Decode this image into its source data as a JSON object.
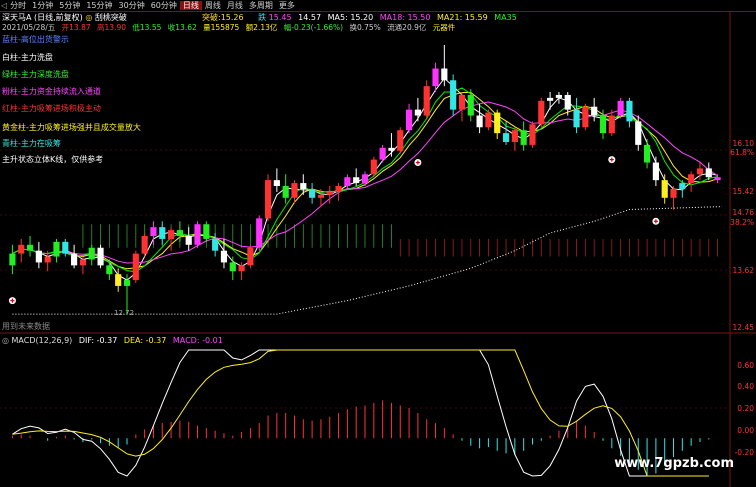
{
  "tabs": [
    "分时",
    "1分钟",
    "5分钟",
    "15分钟",
    "30分钟",
    "60分钟",
    "日线",
    "周线",
    "月线",
    "多周期",
    "更多"
  ],
  "active_tab": "日线",
  "header": {
    "stock": "深天马A (日线,前复权)",
    "indicator_prefix": "◎",
    "indicator": "刮桃突破",
    "breakout_label": "突破:",
    "breakout_value": "15.26",
    "fall_label": "跌",
    "fall_value": "15.45",
    "mid_value": "14.57",
    "ma5": "MA5: 15.20",
    "ma18": "MA18: 15.50",
    "ma21": "MA21: 15.59",
    "ma35": "MA35"
  },
  "info_bar": {
    "date": "2021/05/28/五",
    "open": "开13.87",
    "high": "高13.90",
    "low": "低13.55",
    "close": "收13.62",
    "volume": "量155875",
    "amount": "额2.13亿",
    "change": "幅-0.23(-1.66%)",
    "turnover": "换0.75%",
    "float_cap": "流通20.9亿",
    "unit": "元器件"
  },
  "legend": [
    {
      "text": "蓝柱-高位出货警示",
      "color": "#5a86ff"
    },
    {
      "text": "白柱-主力洗盘",
      "color": "#ffffff"
    },
    {
      "text": "绿柱-主力深度洗盘",
      "color": "#33ee33"
    },
    {
      "text": "粉柱-主力资金持续流入通道",
      "color": "#ff44ff"
    },
    {
      "text": "红柱-主力吸筹进场积极主动",
      "color": "#ff3333"
    },
    {
      "text": "黄金柱-主力吸筹进场强并且成交量放大",
      "color": "#ffee22"
    },
    {
      "text": "青柱-主力在吸筹",
      "color": "#33e6e6"
    },
    {
      "text": "主升状态立体K线，仅供参考",
      "color": "#ffffff"
    }
  ],
  "price_axis": [
    "16.10",
    "61.8%",
    "15.42",
    "14.76",
    "38.2%",
    "13.62",
    "12.45"
  ],
  "low_mark": "12.72",
  "future_note": "用到未来数据",
  "macd": {
    "title": "MACD(12,26,9)",
    "dif": "DIF: -0.37",
    "dea": "DEA: -0.37",
    "macd": "MACD: -0.01",
    "axis": [
      "0.60",
      "0.40",
      "0.20",
      "0.00",
      "-0.20"
    ]
  },
  "watermark": "www.7gpzb.com",
  "colors": {
    "up": "#ff3232",
    "down": "#33e6e6",
    "pink": "#ff33ff",
    "green": "#22ee22",
    "white": "#ffffff",
    "yellow": "#ffee22",
    "ma5": "#ffffff",
    "ma10": "#ffee22",
    "ma20": "#ff44ff",
    "ma30": "#00ee00",
    "grid": "#7a1414",
    "dif": "#ffffff",
    "dea": "#ffee22"
  },
  "chart_data": {
    "type": "candlestick",
    "price_range": [
      12.45,
      17.3
    ],
    "candles": [
      [
        13.55,
        13.9,
        13.4,
        13.75,
        "green"
      ],
      [
        13.75,
        14.0,
        13.6,
        13.9,
        "red"
      ],
      [
        13.9,
        14.05,
        13.7,
        13.8,
        "green"
      ],
      [
        13.8,
        13.95,
        13.5,
        13.6,
        "white"
      ],
      [
        13.6,
        13.8,
        13.45,
        13.7,
        "red"
      ],
      [
        13.7,
        14.0,
        13.6,
        13.95,
        "green"
      ],
      [
        13.95,
        14.0,
        13.7,
        13.75,
        "cyan"
      ],
      [
        13.75,
        13.9,
        13.5,
        13.55,
        "white"
      ],
      [
        13.55,
        13.7,
        13.4,
        13.65,
        "red"
      ],
      [
        13.65,
        13.9,
        13.55,
        13.85,
        "green"
      ],
      [
        13.85,
        13.9,
        13.5,
        13.55,
        "white"
      ],
      [
        13.55,
        13.65,
        13.3,
        13.4,
        "green"
      ],
      [
        13.4,
        13.5,
        13.1,
        13.2,
        "yellow"
      ],
      [
        13.2,
        13.4,
        12.72,
        13.3,
        "green"
      ],
      [
        13.3,
        13.8,
        13.25,
        13.75,
        "red"
      ],
      [
        13.75,
        14.1,
        13.7,
        14.05,
        "red"
      ],
      [
        14.05,
        14.3,
        13.9,
        14.2,
        "pink"
      ],
      [
        14.2,
        14.3,
        13.9,
        14.0,
        "cyan"
      ],
      [
        14.0,
        14.2,
        13.8,
        14.15,
        "red"
      ],
      [
        14.15,
        14.3,
        13.95,
        14.05,
        "green"
      ],
      [
        14.05,
        14.2,
        13.8,
        13.9,
        "white"
      ],
      [
        13.9,
        14.3,
        13.85,
        14.25,
        "pink"
      ],
      [
        14.25,
        14.3,
        13.95,
        14.0,
        "green"
      ],
      [
        14.0,
        14.1,
        13.7,
        13.8,
        "cyan"
      ],
      [
        13.8,
        14.0,
        13.5,
        13.6,
        "white"
      ],
      [
        13.6,
        13.7,
        13.3,
        13.45,
        "green"
      ],
      [
        13.45,
        13.6,
        13.3,
        13.55,
        "red"
      ],
      [
        13.55,
        13.9,
        13.5,
        13.85,
        "red"
      ],
      [
        13.85,
        14.4,
        13.8,
        14.35,
        "pink"
      ],
      [
        14.35,
        15.1,
        14.3,
        15.0,
        "red"
      ],
      [
        15.0,
        15.2,
        14.8,
        14.9,
        "white"
      ],
      [
        14.9,
        15.1,
        14.6,
        14.7,
        "green"
      ],
      [
        14.7,
        15.0,
        14.6,
        14.95,
        "red"
      ],
      [
        14.95,
        15.1,
        14.75,
        14.85,
        "white"
      ],
      [
        14.85,
        14.95,
        14.6,
        14.7,
        "cyan"
      ],
      [
        14.7,
        14.85,
        14.55,
        14.75,
        "red"
      ],
      [
        14.75,
        14.9,
        14.6,
        14.8,
        "red"
      ],
      [
        14.8,
        14.95,
        14.65,
        14.9,
        "red"
      ],
      [
        14.9,
        15.1,
        14.85,
        15.05,
        "pink"
      ],
      [
        15.05,
        15.2,
        14.9,
        14.95,
        "white"
      ],
      [
        14.95,
        15.15,
        14.9,
        15.1,
        "pink"
      ],
      [
        15.1,
        15.4,
        15.05,
        15.35,
        "red"
      ],
      [
        15.35,
        15.6,
        15.3,
        15.55,
        "pink"
      ],
      [
        15.55,
        15.8,
        15.4,
        15.5,
        "white"
      ],
      [
        15.5,
        15.9,
        15.45,
        15.85,
        "red"
      ],
      [
        15.85,
        16.3,
        15.8,
        16.2,
        "pink"
      ],
      [
        16.2,
        16.4,
        16.0,
        16.1,
        "white"
      ],
      [
        16.1,
        16.7,
        16.05,
        16.6,
        "red"
      ],
      [
        16.6,
        17.0,
        16.5,
        16.9,
        "pink"
      ],
      [
        16.9,
        17.3,
        16.6,
        16.7,
        "white"
      ],
      [
        16.7,
        16.8,
        16.1,
        16.2,
        "cyan"
      ],
      [
        16.2,
        16.5,
        16.0,
        16.45,
        "red"
      ],
      [
        16.45,
        16.55,
        16.0,
        16.1,
        "green"
      ],
      [
        16.1,
        16.3,
        15.8,
        15.9,
        "white"
      ],
      [
        15.9,
        16.2,
        15.85,
        16.15,
        "red"
      ],
      [
        16.15,
        16.2,
        15.7,
        15.8,
        "yellow"
      ],
      [
        15.8,
        16.0,
        15.6,
        15.65,
        "cyan"
      ],
      [
        15.65,
        15.9,
        15.5,
        15.85,
        "red"
      ],
      [
        15.85,
        16.0,
        15.5,
        15.6,
        "green"
      ],
      [
        15.6,
        16.0,
        15.55,
        15.95,
        "red"
      ],
      [
        15.95,
        16.4,
        15.9,
        16.35,
        "red"
      ],
      [
        16.35,
        16.5,
        16.2,
        16.4,
        "white"
      ],
      [
        16.4,
        16.5,
        16.3,
        16.45,
        "white"
      ],
      [
        16.45,
        16.5,
        16.1,
        16.2,
        "white"
      ],
      [
        16.2,
        16.4,
        15.8,
        15.9,
        "cyan"
      ],
      [
        15.9,
        16.3,
        15.85,
        16.25,
        "red"
      ],
      [
        16.25,
        16.4,
        16.0,
        16.1,
        "white"
      ],
      [
        16.1,
        16.2,
        15.7,
        15.8,
        "green"
      ],
      [
        15.8,
        16.2,
        15.75,
        16.1,
        "red"
      ],
      [
        16.1,
        16.4,
        16.05,
        16.35,
        "pink"
      ],
      [
        16.35,
        16.4,
        15.9,
        16.0,
        "cyan"
      ],
      [
        16.0,
        16.1,
        15.5,
        15.6,
        "white"
      ],
      [
        15.6,
        15.7,
        15.2,
        15.3,
        "green"
      ],
      [
        15.3,
        15.4,
        14.9,
        15.0,
        "white"
      ],
      [
        15.0,
        15.1,
        14.6,
        14.7,
        "yellow"
      ],
      [
        14.7,
        14.9,
        14.5,
        14.85,
        "red"
      ],
      [
        14.85,
        15.0,
        14.7,
        14.95,
        "cyan"
      ],
      [
        14.95,
        15.15,
        14.8,
        15.1,
        "red"
      ],
      [
        15.1,
        15.3,
        15.0,
        15.2,
        "red"
      ],
      [
        15.2,
        15.3,
        15.0,
        15.05,
        "white"
      ],
      [
        15.05,
        15.1,
        14.95,
        15.0,
        "pink"
      ]
    ],
    "macd_hist": [
      0.02,
      0.03,
      0.02,
      0.0,
      -0.02,
      0.01,
      0.02,
      -0.01,
      -0.03,
      -0.01,
      -0.04,
      -0.06,
      -0.08,
      -0.05,
      0.03,
      0.07,
      0.1,
      0.12,
      0.13,
      0.14,
      0.13,
      0.1,
      0.08,
      0.06,
      0.04,
      0.02,
      0.05,
      0.08,
      0.12,
      0.18,
      0.2,
      0.2,
      0.18,
      0.15,
      0.14,
      0.15,
      0.17,
      0.2,
      0.23,
      0.25,
      0.26,
      0.28,
      0.3,
      0.28,
      0.26,
      0.24,
      0.2,
      0.15,
      0.12,
      0.08,
      0.03,
      -0.02,
      -0.06,
      -0.08,
      -0.07,
      -0.1,
      -0.12,
      -0.13,
      -0.1,
      -0.05,
      -0.02,
      0.02,
      0.06,
      0.1,
      0.14,
      0.1,
      0.05,
      -0.02,
      -0.08,
      -0.14,
      -0.2,
      -0.25,
      -0.3,
      -0.28,
      -0.22,
      -0.15,
      -0.1,
      -0.06,
      -0.03,
      -0.01
    ],
    "macd_range": [
      -0.3,
      0.7
    ]
  }
}
